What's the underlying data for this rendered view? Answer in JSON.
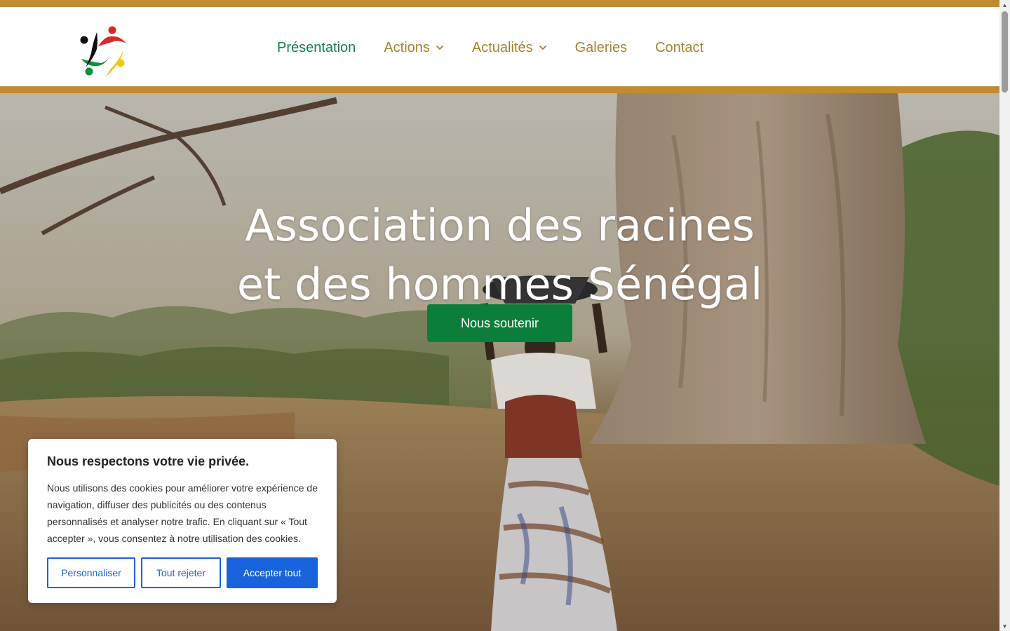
{
  "nav": {
    "items": [
      {
        "label": "Présentation",
        "active": true,
        "dropdown": false
      },
      {
        "label": "Actions",
        "active": false,
        "dropdown": true
      },
      {
        "label": "Actualités",
        "active": false,
        "dropdown": true
      },
      {
        "label": "Galeries",
        "active": false,
        "dropdown": false
      },
      {
        "label": "Contact",
        "active": false,
        "dropdown": false
      }
    ]
  },
  "hero": {
    "title_line1": "Association des racines",
    "title_line2": "et des hommes Sénégal",
    "cta_label": "Nous soutenir"
  },
  "cookie": {
    "title": "Nous respectons votre vie privée.",
    "text": "Nous utilisons des cookies pour améliorer votre expérience de navigation, diffuser des publicités ou des contenus personnalisés et analyser notre trafic. En cliquant sur « Tout accepter », vous consentez à notre utilisation des cookies.",
    "customize_label": "Personnaliser",
    "reject_label": "Tout rejeter",
    "accept_label": "Accepter tout"
  },
  "colors": {
    "accent_gold": "#c08c32",
    "nav_gold": "#a58231",
    "brand_green": "#0c7e3b",
    "cookie_blue": "#1863dc"
  },
  "icons": {
    "logo": "people-circle-logo",
    "dropdown": "chevron-down-icon"
  }
}
